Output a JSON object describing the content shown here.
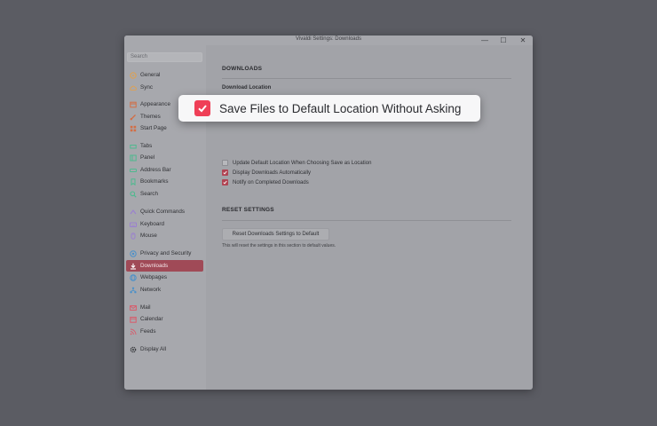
{
  "window": {
    "title": "Vivaldi Settings: Downloads",
    "controls": {
      "minimize": "—",
      "maximize": "☐",
      "close": "✕"
    }
  },
  "sidebar": {
    "search_placeholder": "Search",
    "items": [
      {
        "label": "General",
        "icon": "gear-circle-icon",
        "color": "#d9a15a"
      },
      {
        "label": "Sync",
        "icon": "cloud-icon",
        "color": "#d9a15a"
      },
      {
        "label": "Appearance",
        "icon": "window-icon",
        "color": "#d26e45"
      },
      {
        "label": "Themes",
        "icon": "brush-icon",
        "color": "#d26e45"
      },
      {
        "label": "Start Page",
        "icon": "grid-icon",
        "color": "#d26e45"
      },
      {
        "label": "Tabs",
        "icon": "tabs-icon",
        "color": "#4fb98f"
      },
      {
        "label": "Panel",
        "icon": "panel-icon",
        "color": "#4fb98f"
      },
      {
        "label": "Address Bar",
        "icon": "address-bar-icon",
        "color": "#4fb98f"
      },
      {
        "label": "Bookmarks",
        "icon": "bookmark-icon",
        "color": "#4fb98f"
      },
      {
        "label": "Search",
        "icon": "search-icon",
        "color": "#4fb98f"
      },
      {
        "label": "Quick Commands",
        "icon": "quick-commands-icon",
        "color": "#9a7fd0"
      },
      {
        "label": "Keyboard",
        "icon": "keyboard-icon",
        "color": "#9a7fd0"
      },
      {
        "label": "Mouse",
        "icon": "mouse-icon",
        "color": "#9a7fd0"
      },
      {
        "label": "Privacy and Security",
        "icon": "shield-icon",
        "color": "#4a90c9"
      },
      {
        "label": "Downloads",
        "icon": "download-icon",
        "color": "#ffffff",
        "active": true
      },
      {
        "label": "Webpages",
        "icon": "globe-icon",
        "color": "#4a90c9"
      },
      {
        "label": "Network",
        "icon": "network-icon",
        "color": "#4a90c9"
      },
      {
        "label": "Mail",
        "icon": "mail-icon",
        "color": "#d95a6a"
      },
      {
        "label": "Calendar",
        "icon": "calendar-icon",
        "color": "#d95a6a"
      },
      {
        "label": "Feeds",
        "icon": "rss-icon",
        "color": "#d95a6a"
      },
      {
        "label": "Display All",
        "icon": "gear-icon",
        "color": "#3a3b3f"
      }
    ]
  },
  "downloads": {
    "section_title": "DOWNLOADS",
    "location_label": "Download Location",
    "options": [
      {
        "label": "Update Default Location When Choosing Save as Location",
        "checked": false
      },
      {
        "label": "Display Downloads Automatically",
        "checked": true
      },
      {
        "label": "Notify on Completed Downloads",
        "checked": true
      }
    ]
  },
  "reset": {
    "section_title": "RESET SETTINGS",
    "button_label": "Reset Downloads Settings to Default",
    "hint": "This will reset the settings in this section to default values."
  },
  "callout": {
    "label": "Save Files to Default Location Without Asking",
    "checked": true
  },
  "colors": {
    "accent": "#ef3f57",
    "accent_dim": "#b04453",
    "backdrop": "#5b5c63"
  }
}
